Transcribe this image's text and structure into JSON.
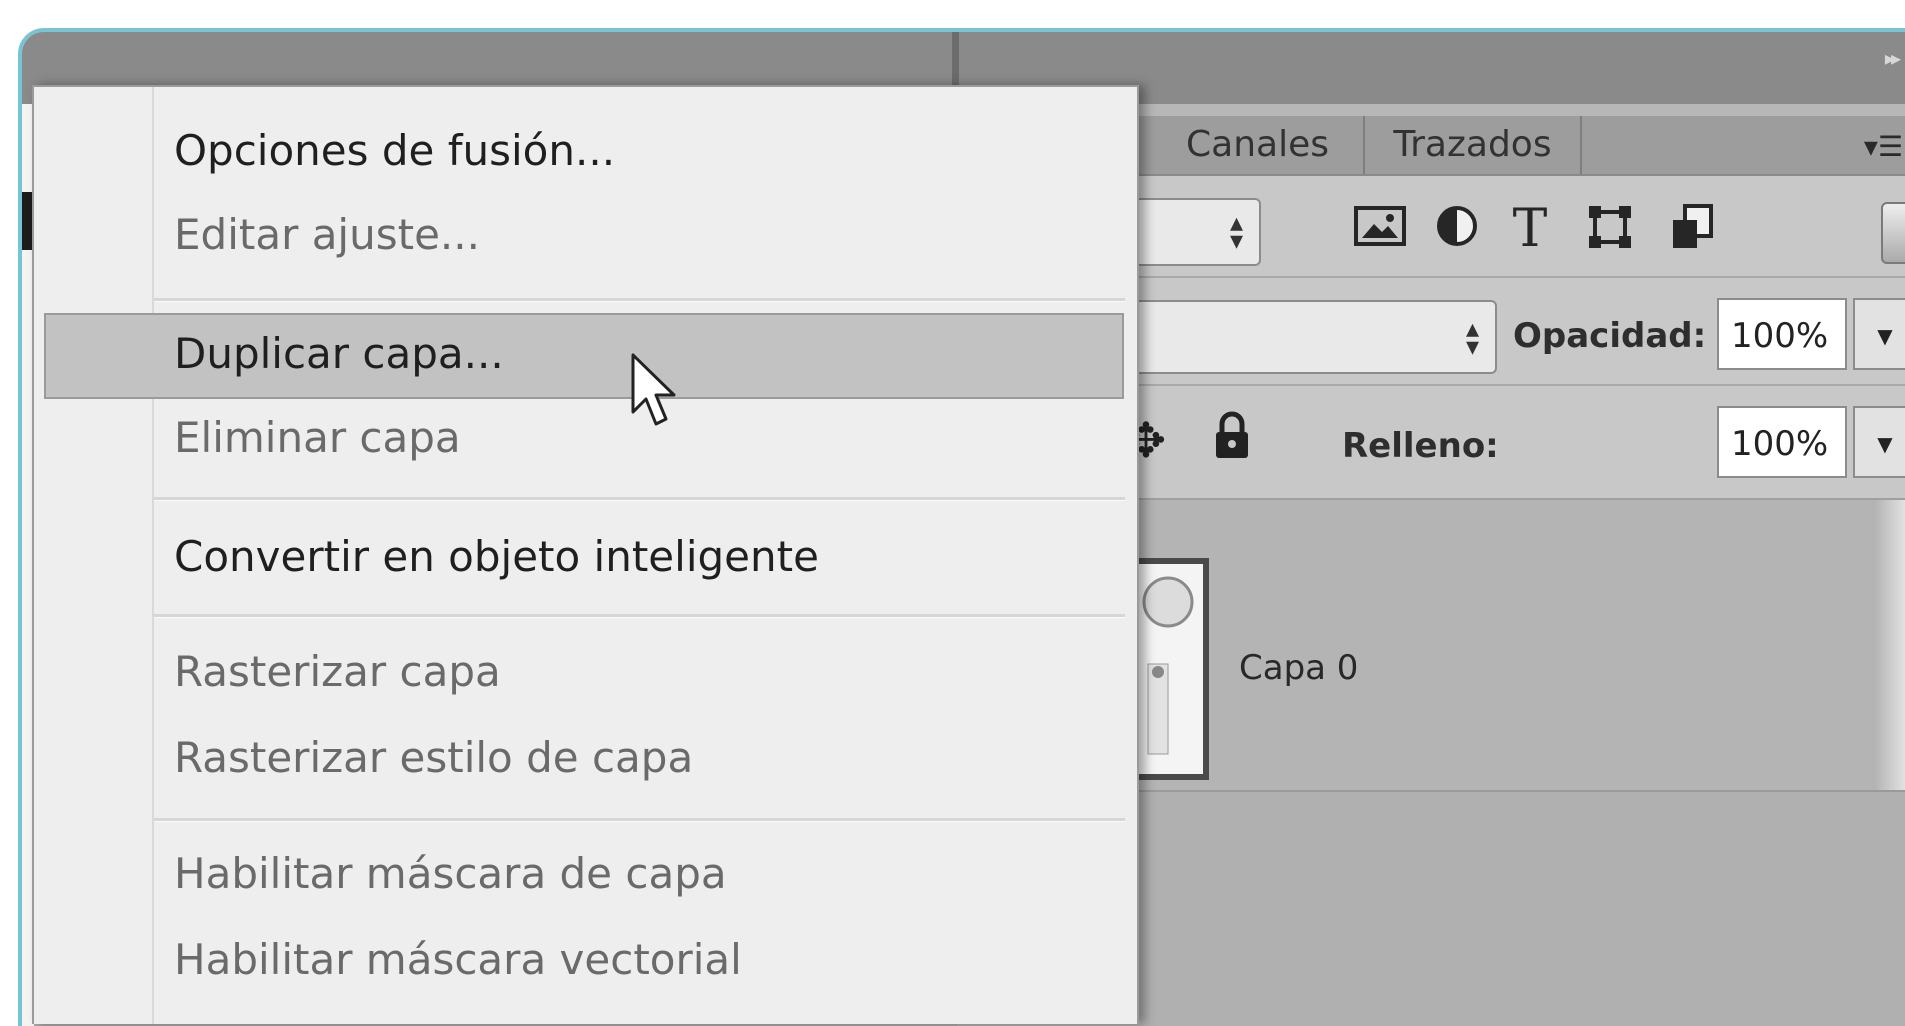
{
  "panel": {
    "tabs": [
      {
        "label": "Canales"
      },
      {
        "label": "Trazados"
      }
    ],
    "opacity_label": "Opacidad:",
    "opacity_value": "100%",
    "fill_label": "Relleno:",
    "fill_value": "100%",
    "layer": {
      "name": "Capa 0"
    }
  },
  "context_menu": {
    "items": [
      {
        "label": "Opciones de fusión...",
        "enabled": true
      },
      {
        "label": "Editar ajuste...",
        "enabled": false
      },
      {
        "label": "Duplicar capa...",
        "enabled": true,
        "highlighted": true
      },
      {
        "label": "Eliminar capa",
        "enabled": false
      },
      {
        "label": "Convertir en objeto inteligente",
        "enabled": true
      },
      {
        "label": "Rasterizar capa",
        "enabled": false
      },
      {
        "label": "Rasterizar estilo de capa",
        "enabled": false
      },
      {
        "label": "Habilitar máscara de capa",
        "enabled": false
      },
      {
        "label": "Habilitar máscara vectorial",
        "enabled": false
      }
    ]
  },
  "icons": {
    "filter": [
      "image-icon",
      "adjustment-icon",
      "type-icon",
      "shape-icon",
      "smart-object-icon"
    ],
    "lock": [
      "lock-pixels-icon",
      "brush-icon",
      "move-icon",
      "lock-icon"
    ]
  },
  "colors": {
    "frame_accent": "#79c4d4",
    "menu_background": "#eeeeee",
    "menu_highlight": "#c2c2c2"
  }
}
